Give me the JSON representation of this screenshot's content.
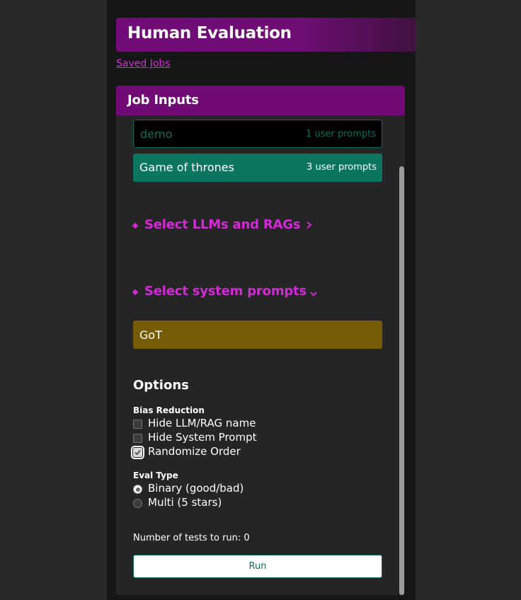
{
  "header": {
    "title": "Human Evaluation"
  },
  "links": {
    "saved_jobs": "Saved Jobs"
  },
  "panel": {
    "title": "Job Inputs"
  },
  "user_prompt_sets": [
    {
      "name": "demo",
      "count": "1 user prompts"
    },
    {
      "name": "Game of thrones",
      "count": "3 user prompts"
    }
  ],
  "sections": {
    "llms": {
      "title": "Select LLMs and RAGs",
      "state": "collapsed"
    },
    "system_prompts": {
      "title": "Select system prompts",
      "state": "expanded"
    }
  },
  "system_prompts": [
    {
      "name": "GoT"
    }
  ],
  "options": {
    "title": "Options",
    "bias_label": "Bias Reduction",
    "bias": [
      {
        "label": "Hide LLM/RAG name",
        "checked": false
      },
      {
        "label": "Hide System Prompt",
        "checked": false
      },
      {
        "label": "Randomize Order",
        "checked": true
      }
    ],
    "eval_label": "Eval Type",
    "eval": [
      {
        "label": "Binary (good/bad)",
        "selected": true
      },
      {
        "label": "Multi (5 stars)",
        "selected": false
      }
    ]
  },
  "tests_label": "Number of tests to run: 0",
  "run_label": "Run",
  "colors": {
    "accent": "#d22ad6",
    "header": "#720c78",
    "teal": "#0b7560",
    "gold": "#775c08"
  },
  "icons": {
    "llm_section": "chevron-right-icon",
    "system_section": "chevron-down-icon",
    "section_bullet": "diamond-icon"
  }
}
